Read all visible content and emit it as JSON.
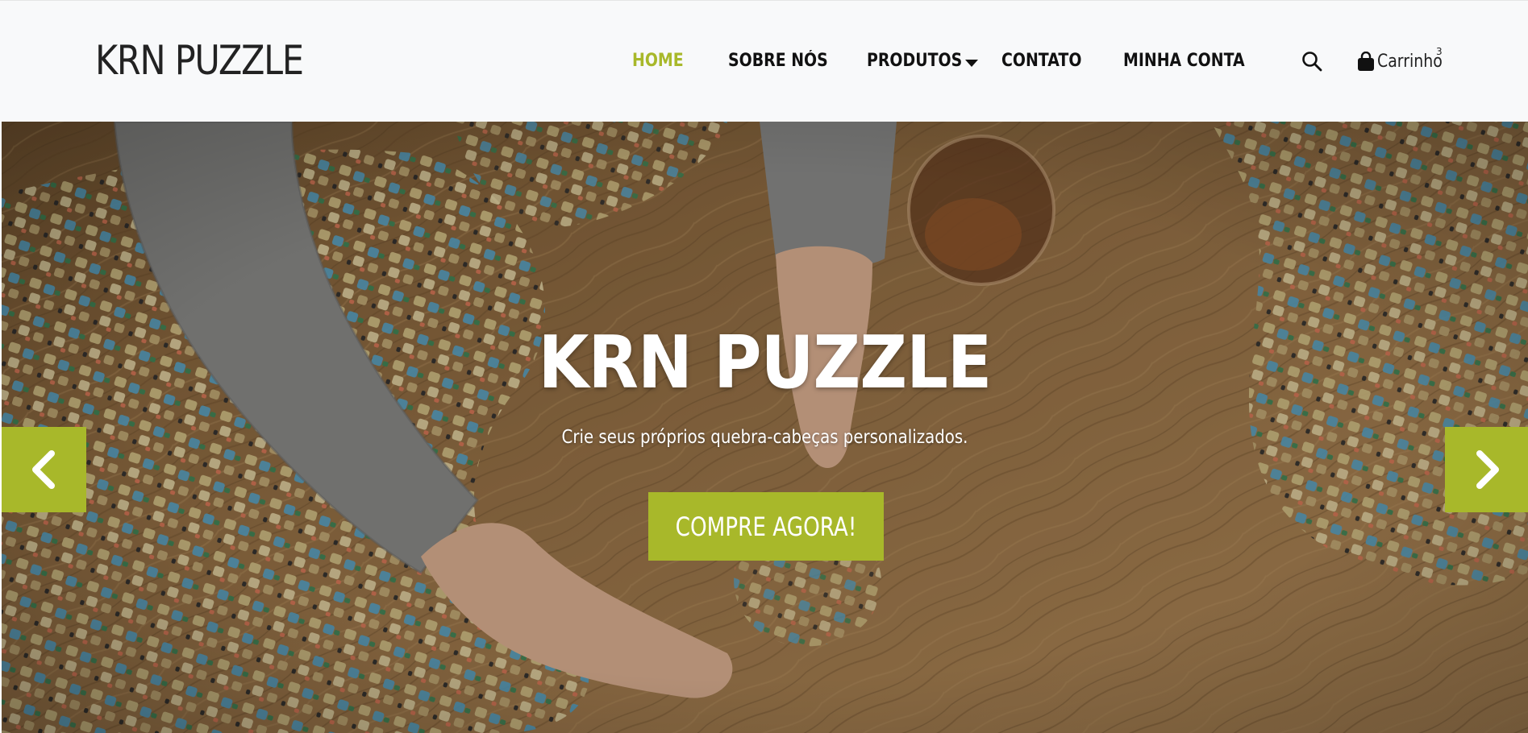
{
  "brand": {
    "logo_text": "KRN PUZZLE",
    "accent_color": "#a8b82a"
  },
  "nav": {
    "items": [
      {
        "label": "HOME",
        "active": true
      },
      {
        "label": "SOBRE NÓS",
        "active": false
      },
      {
        "label": "PRODUTOS",
        "active": false,
        "has_dropdown": true
      },
      {
        "label": "CONTATO",
        "active": false
      },
      {
        "label": "MINHA CONTA",
        "active": false
      }
    ],
    "search_icon": "search-icon",
    "cart": {
      "icon": "shopping-bag-icon",
      "label": "Carrinho",
      "count": "3"
    }
  },
  "hero": {
    "title": "KRN PUZZLE",
    "subtitle": "Crie seus próprios quebra-cabeças personalizados.",
    "cta_label": "COMPRE AGORA!",
    "prev_icon": "chevron-left-icon",
    "next_icon": "chevron-right-icon"
  }
}
